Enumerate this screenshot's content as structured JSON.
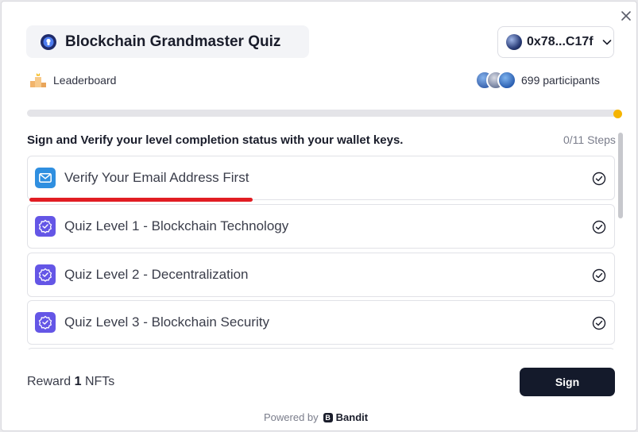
{
  "header": {
    "title": "Blockchain Grandmaster Quiz",
    "wallet_address": "0x78...C17f"
  },
  "leaderboard_label": "Leaderboard",
  "participants_label": "699 participants",
  "progress": {
    "completed_fraction": 0.0,
    "accent": "#f5b400"
  },
  "instruction": "Sign and Verify your level completion status with your wallet keys.",
  "steps_counter": "0/11 Steps",
  "tasks": [
    {
      "label": "Verify Your Email Address First",
      "icon": "mail-icon",
      "done": false
    },
    {
      "label": "Quiz Level 1 - Blockchain Technology",
      "icon": "quiz-badge-icon",
      "done": false
    },
    {
      "label": "Quiz Level 2 - Decentralization",
      "icon": "quiz-badge-icon",
      "done": false
    },
    {
      "label": "Quiz Level 3 - Blockchain Security",
      "icon": "quiz-badge-icon",
      "done": false
    }
  ],
  "footer": {
    "reward_prefix": "Reward",
    "reward_count": "1",
    "reward_suffix": "NFTs",
    "sign_label": "Sign",
    "powered_by": "Powered by",
    "brand_mark": "B",
    "brand": "Bandit"
  },
  "colors": {
    "highlight_underline": "#e11d23",
    "mail_icon": "#2f8fe0",
    "quiz_icon": "#6456e6",
    "primary_button": "#141a2b"
  }
}
